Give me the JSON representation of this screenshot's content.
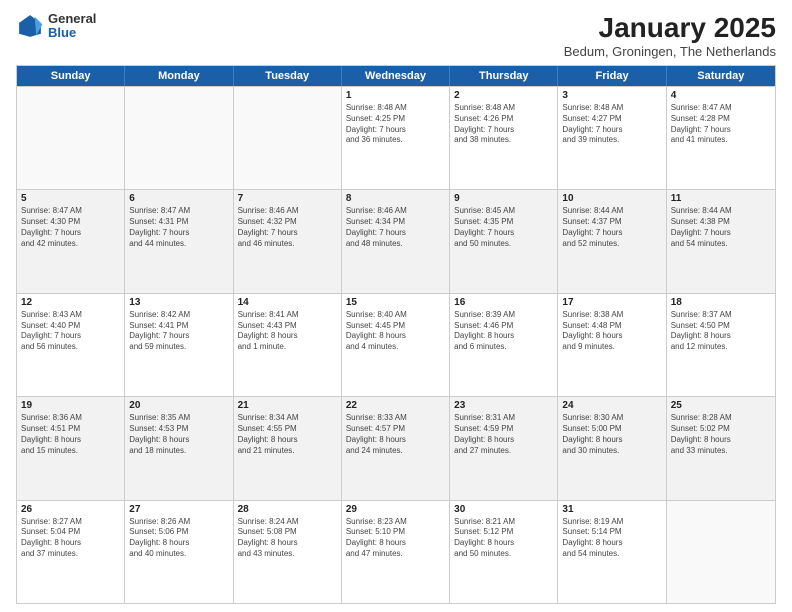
{
  "header": {
    "logo": {
      "general": "General",
      "blue": "Blue"
    },
    "title": "January 2025",
    "subtitle": "Bedum, Groningen, The Netherlands"
  },
  "days": [
    "Sunday",
    "Monday",
    "Tuesday",
    "Wednesday",
    "Thursday",
    "Friday",
    "Saturday"
  ],
  "weeks": [
    [
      {
        "num": "",
        "empty": true
      },
      {
        "num": "",
        "empty": true
      },
      {
        "num": "",
        "empty": true
      },
      {
        "num": "1",
        "lines": [
          "Sunrise: 8:48 AM",
          "Sunset: 4:25 PM",
          "Daylight: 7 hours",
          "and 36 minutes."
        ]
      },
      {
        "num": "2",
        "lines": [
          "Sunrise: 8:48 AM",
          "Sunset: 4:26 PM",
          "Daylight: 7 hours",
          "and 38 minutes."
        ]
      },
      {
        "num": "3",
        "lines": [
          "Sunrise: 8:48 AM",
          "Sunset: 4:27 PM",
          "Daylight: 7 hours",
          "and 39 minutes."
        ]
      },
      {
        "num": "4",
        "lines": [
          "Sunrise: 8:47 AM",
          "Sunset: 4:28 PM",
          "Daylight: 7 hours",
          "and 41 minutes."
        ]
      }
    ],
    [
      {
        "num": "5",
        "lines": [
          "Sunrise: 8:47 AM",
          "Sunset: 4:30 PM",
          "Daylight: 7 hours",
          "and 42 minutes."
        ]
      },
      {
        "num": "6",
        "lines": [
          "Sunrise: 8:47 AM",
          "Sunset: 4:31 PM",
          "Daylight: 7 hours",
          "and 44 minutes."
        ]
      },
      {
        "num": "7",
        "lines": [
          "Sunrise: 8:46 AM",
          "Sunset: 4:32 PM",
          "Daylight: 7 hours",
          "and 46 minutes."
        ]
      },
      {
        "num": "8",
        "lines": [
          "Sunrise: 8:46 AM",
          "Sunset: 4:34 PM",
          "Daylight: 7 hours",
          "and 48 minutes."
        ]
      },
      {
        "num": "9",
        "lines": [
          "Sunrise: 8:45 AM",
          "Sunset: 4:35 PM",
          "Daylight: 7 hours",
          "and 50 minutes."
        ]
      },
      {
        "num": "10",
        "lines": [
          "Sunrise: 8:44 AM",
          "Sunset: 4:37 PM",
          "Daylight: 7 hours",
          "and 52 minutes."
        ]
      },
      {
        "num": "11",
        "lines": [
          "Sunrise: 8:44 AM",
          "Sunset: 4:38 PM",
          "Daylight: 7 hours",
          "and 54 minutes."
        ]
      }
    ],
    [
      {
        "num": "12",
        "lines": [
          "Sunrise: 8:43 AM",
          "Sunset: 4:40 PM",
          "Daylight: 7 hours",
          "and 56 minutes."
        ]
      },
      {
        "num": "13",
        "lines": [
          "Sunrise: 8:42 AM",
          "Sunset: 4:41 PM",
          "Daylight: 7 hours",
          "and 59 minutes."
        ]
      },
      {
        "num": "14",
        "lines": [
          "Sunrise: 8:41 AM",
          "Sunset: 4:43 PM",
          "Daylight: 8 hours",
          "and 1 minute."
        ]
      },
      {
        "num": "15",
        "lines": [
          "Sunrise: 8:40 AM",
          "Sunset: 4:45 PM",
          "Daylight: 8 hours",
          "and 4 minutes."
        ]
      },
      {
        "num": "16",
        "lines": [
          "Sunrise: 8:39 AM",
          "Sunset: 4:46 PM",
          "Daylight: 8 hours",
          "and 6 minutes."
        ]
      },
      {
        "num": "17",
        "lines": [
          "Sunrise: 8:38 AM",
          "Sunset: 4:48 PM",
          "Daylight: 8 hours",
          "and 9 minutes."
        ]
      },
      {
        "num": "18",
        "lines": [
          "Sunrise: 8:37 AM",
          "Sunset: 4:50 PM",
          "Daylight: 8 hours",
          "and 12 minutes."
        ]
      }
    ],
    [
      {
        "num": "19",
        "lines": [
          "Sunrise: 8:36 AM",
          "Sunset: 4:51 PM",
          "Daylight: 8 hours",
          "and 15 minutes."
        ]
      },
      {
        "num": "20",
        "lines": [
          "Sunrise: 8:35 AM",
          "Sunset: 4:53 PM",
          "Daylight: 8 hours",
          "and 18 minutes."
        ]
      },
      {
        "num": "21",
        "lines": [
          "Sunrise: 8:34 AM",
          "Sunset: 4:55 PM",
          "Daylight: 8 hours",
          "and 21 minutes."
        ]
      },
      {
        "num": "22",
        "lines": [
          "Sunrise: 8:33 AM",
          "Sunset: 4:57 PM",
          "Daylight: 8 hours",
          "and 24 minutes."
        ]
      },
      {
        "num": "23",
        "lines": [
          "Sunrise: 8:31 AM",
          "Sunset: 4:59 PM",
          "Daylight: 8 hours",
          "and 27 minutes."
        ]
      },
      {
        "num": "24",
        "lines": [
          "Sunrise: 8:30 AM",
          "Sunset: 5:00 PM",
          "Daylight: 8 hours",
          "and 30 minutes."
        ]
      },
      {
        "num": "25",
        "lines": [
          "Sunrise: 8:28 AM",
          "Sunset: 5:02 PM",
          "Daylight: 8 hours",
          "and 33 minutes."
        ]
      }
    ],
    [
      {
        "num": "26",
        "lines": [
          "Sunrise: 8:27 AM",
          "Sunset: 5:04 PM",
          "Daylight: 8 hours",
          "and 37 minutes."
        ]
      },
      {
        "num": "27",
        "lines": [
          "Sunrise: 8:26 AM",
          "Sunset: 5:06 PM",
          "Daylight: 8 hours",
          "and 40 minutes."
        ]
      },
      {
        "num": "28",
        "lines": [
          "Sunrise: 8:24 AM",
          "Sunset: 5:08 PM",
          "Daylight: 8 hours",
          "and 43 minutes."
        ]
      },
      {
        "num": "29",
        "lines": [
          "Sunrise: 8:23 AM",
          "Sunset: 5:10 PM",
          "Daylight: 8 hours",
          "and 47 minutes."
        ]
      },
      {
        "num": "30",
        "lines": [
          "Sunrise: 8:21 AM",
          "Sunset: 5:12 PM",
          "Daylight: 8 hours",
          "and 50 minutes."
        ]
      },
      {
        "num": "31",
        "lines": [
          "Sunrise: 8:19 AM",
          "Sunset: 5:14 PM",
          "Daylight: 8 hours",
          "and 54 minutes."
        ]
      },
      {
        "num": "",
        "empty": true
      }
    ]
  ]
}
